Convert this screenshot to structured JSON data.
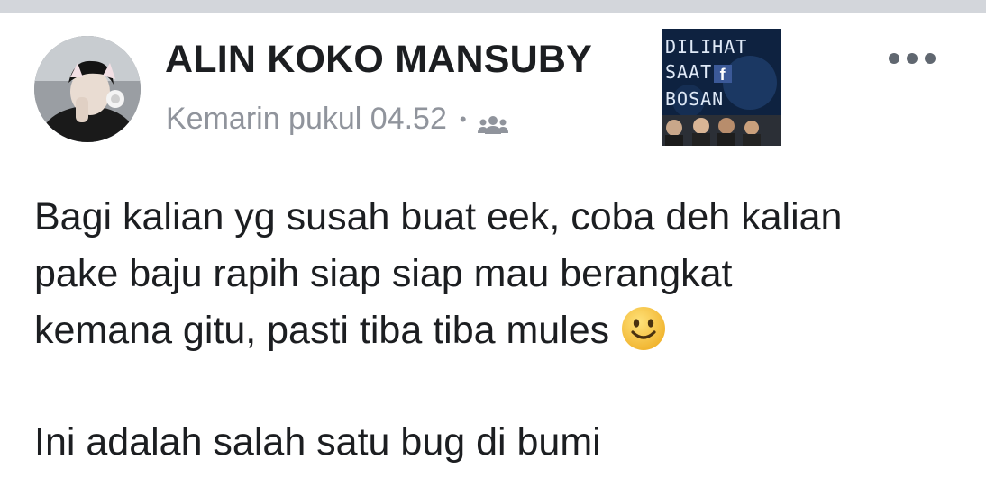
{
  "post": {
    "author_name": "ALIN KOKO MANSUBY",
    "timestamp": "Kemarin pukul 04.52",
    "separator": "•",
    "audience_icon": "friends-icon",
    "more_icon": "more-options-icon",
    "body_lines": [
      "Bagi kalian yg susah buat eek, coba deh kalian",
      "pake baju rapih siap siap mau berangkat",
      "kemana gitu, pasti tiba tiba mules"
    ],
    "body_emoji": "slightly-smiling-face-icon",
    "body_second_paragraph": "Ini adalah salah satu bug di bumi"
  },
  "page_badge": {
    "line1": "DILIHAT",
    "line2": "SAAT",
    "fb_letter": "f",
    "line3": "BOSAN"
  },
  "colors": {
    "author": "#1c1e21",
    "meta": "#90949c",
    "badge_bg": "#0e2240",
    "facebook_blue": "#3b5998",
    "emoji_yellow": "#f7c23f"
  }
}
